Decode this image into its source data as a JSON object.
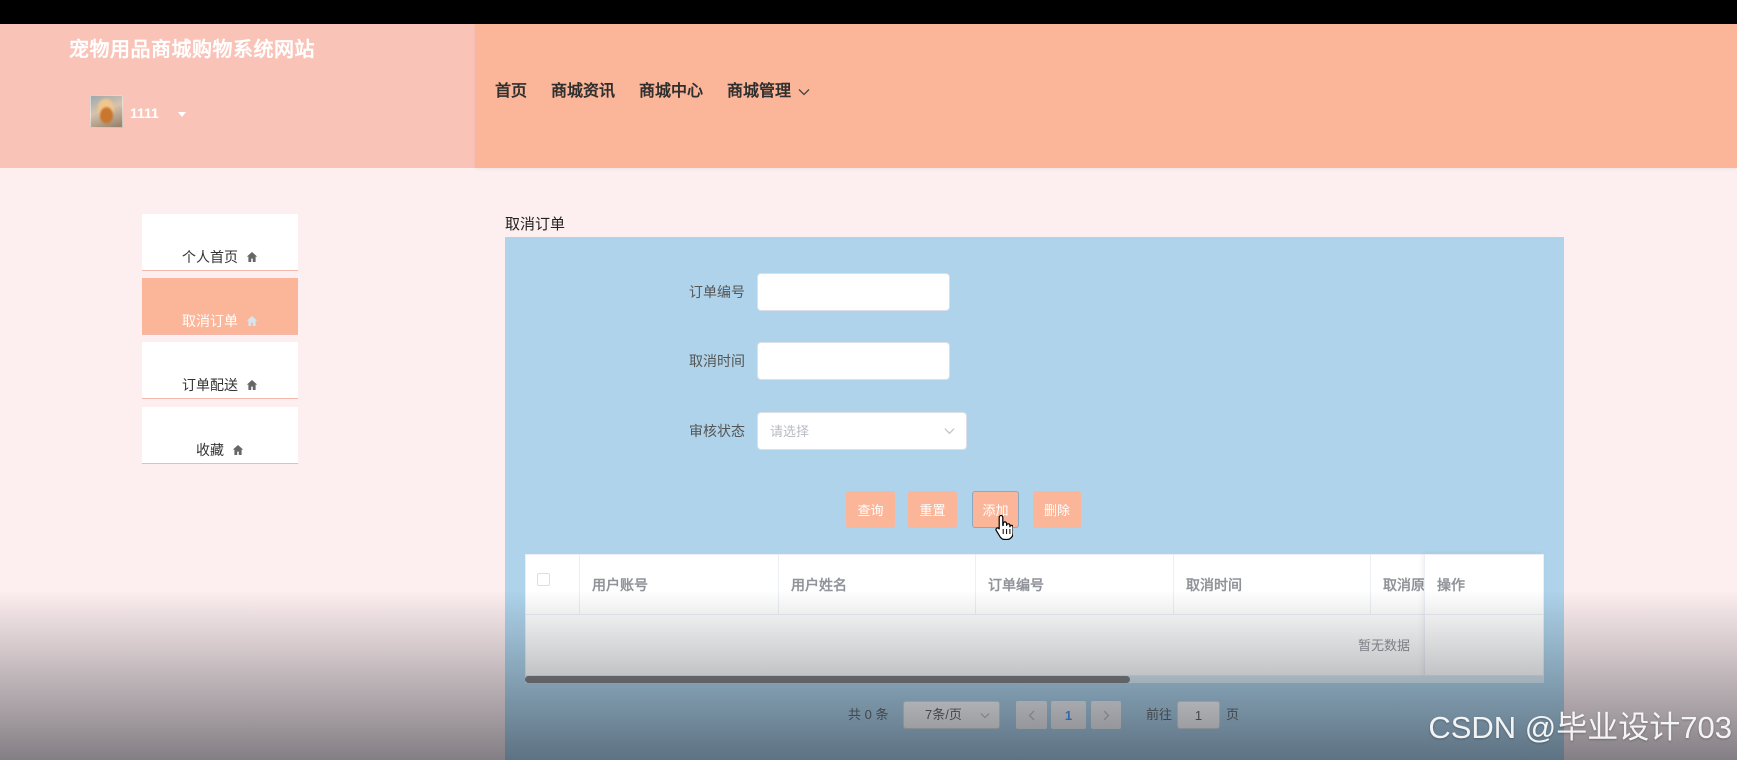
{
  "header": {
    "site_title": "宠物用品商城购物系统网站",
    "username": "1111",
    "user_menu_icon": "caret-down-icon",
    "nav": [
      {
        "label": "首页"
      },
      {
        "label": "商城资讯"
      },
      {
        "label": "商城中心"
      },
      {
        "label": "商城管理",
        "has_dropdown": true,
        "icon": "chevron-down-icon"
      }
    ]
  },
  "sidebar": {
    "items": [
      {
        "label": "个人首页",
        "icon": "home-icon",
        "active": false
      },
      {
        "label": "取消订单",
        "icon": "home-icon",
        "active": true
      },
      {
        "label": "订单配送",
        "icon": "home-icon",
        "active": false
      },
      {
        "label": "收藏",
        "icon": "home-icon",
        "active": false
      }
    ]
  },
  "main": {
    "title": "取消订单",
    "search_form": {
      "order_no": {
        "label": "订单编号",
        "value": ""
      },
      "cancel_time": {
        "label": "取消时间",
        "value": ""
      },
      "review_status": {
        "label": "审核状态",
        "placeholder": "请选择",
        "value": ""
      }
    },
    "actions": {
      "query": "查询",
      "reset": "重置",
      "add": "添加",
      "delete": "删除"
    },
    "table": {
      "columns": [
        "用户账号",
        "用户姓名",
        "订单编号",
        "取消时间",
        "取消原",
        "操作"
      ],
      "rows": [],
      "empty_text": "暂无数据"
    },
    "pagination": {
      "total_text": "共 0 条",
      "page_size": "7条/页",
      "current_page": "1",
      "goto_label": "前往",
      "goto_value": "1",
      "goto_suffix": "页",
      "prev_icon": "chevron-left-icon",
      "next_icon": "chevron-right-icon"
    }
  },
  "watermark": "CSDN @毕业设计703",
  "colors": {
    "header_left": "#fac3b8",
    "header_right": "#fbb598",
    "page_background": "#fdeeef",
    "panel_background": "#aed3ea",
    "accent": "#fbb598",
    "active_page": "#409eff"
  }
}
